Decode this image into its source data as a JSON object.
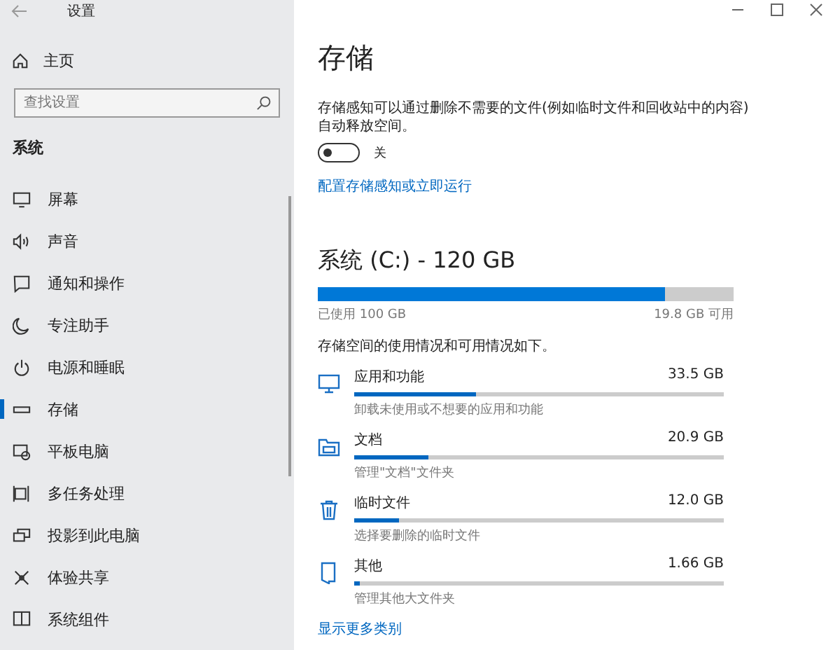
{
  "window": {
    "title": "设置"
  },
  "sidebar": {
    "home": "主页",
    "search": {
      "placeholder": "查找设置"
    },
    "section": "系统",
    "items": [
      {
        "label": "屏幕",
        "selected": false
      },
      {
        "label": "声音",
        "selected": false
      },
      {
        "label": "通知和操作",
        "selected": false
      },
      {
        "label": "专注助手",
        "selected": false
      },
      {
        "label": "电源和睡眠",
        "selected": false
      },
      {
        "label": "存储",
        "selected": true
      },
      {
        "label": "平板电脑",
        "selected": false
      },
      {
        "label": "多任务处理",
        "selected": false
      },
      {
        "label": "投影到此电脑",
        "selected": false
      },
      {
        "label": "体验共享",
        "selected": false
      },
      {
        "label": "系统组件",
        "selected": false
      }
    ]
  },
  "main": {
    "title": "存储",
    "description": "存储感知可以通过删除不需要的文件(例如临时文件和回收站中的内容)自动释放空间。",
    "toggle": {
      "on": false,
      "label": "关"
    },
    "configure_link": "配置存储感知或立即运行",
    "drive": {
      "title": "系统 (C:) - 120 GB",
      "level": 0.835,
      "used": "已使用 100 GB",
      "free": "19.8 GB 可用"
    },
    "usage_intro": "存储空间的使用情况和可用情况如下。",
    "categories": [
      {
        "name": "应用和功能",
        "size": "33.5 GB",
        "level": 0.33,
        "hint": "卸载未使用或不想要的应用和功能"
      },
      {
        "name": "文档",
        "size": "20.9 GB",
        "level": 0.2,
        "hint": "管理\"文档\"文件夹"
      },
      {
        "name": "临时文件",
        "size": "12.0 GB",
        "level": 0.12,
        "hint": "选择要删除的临时文件"
      },
      {
        "name": "其他",
        "size": "1.66 GB",
        "level": 0.015,
        "hint": "管理其他大文件夹"
      }
    ],
    "more_link": "显示更多类别"
  }
}
